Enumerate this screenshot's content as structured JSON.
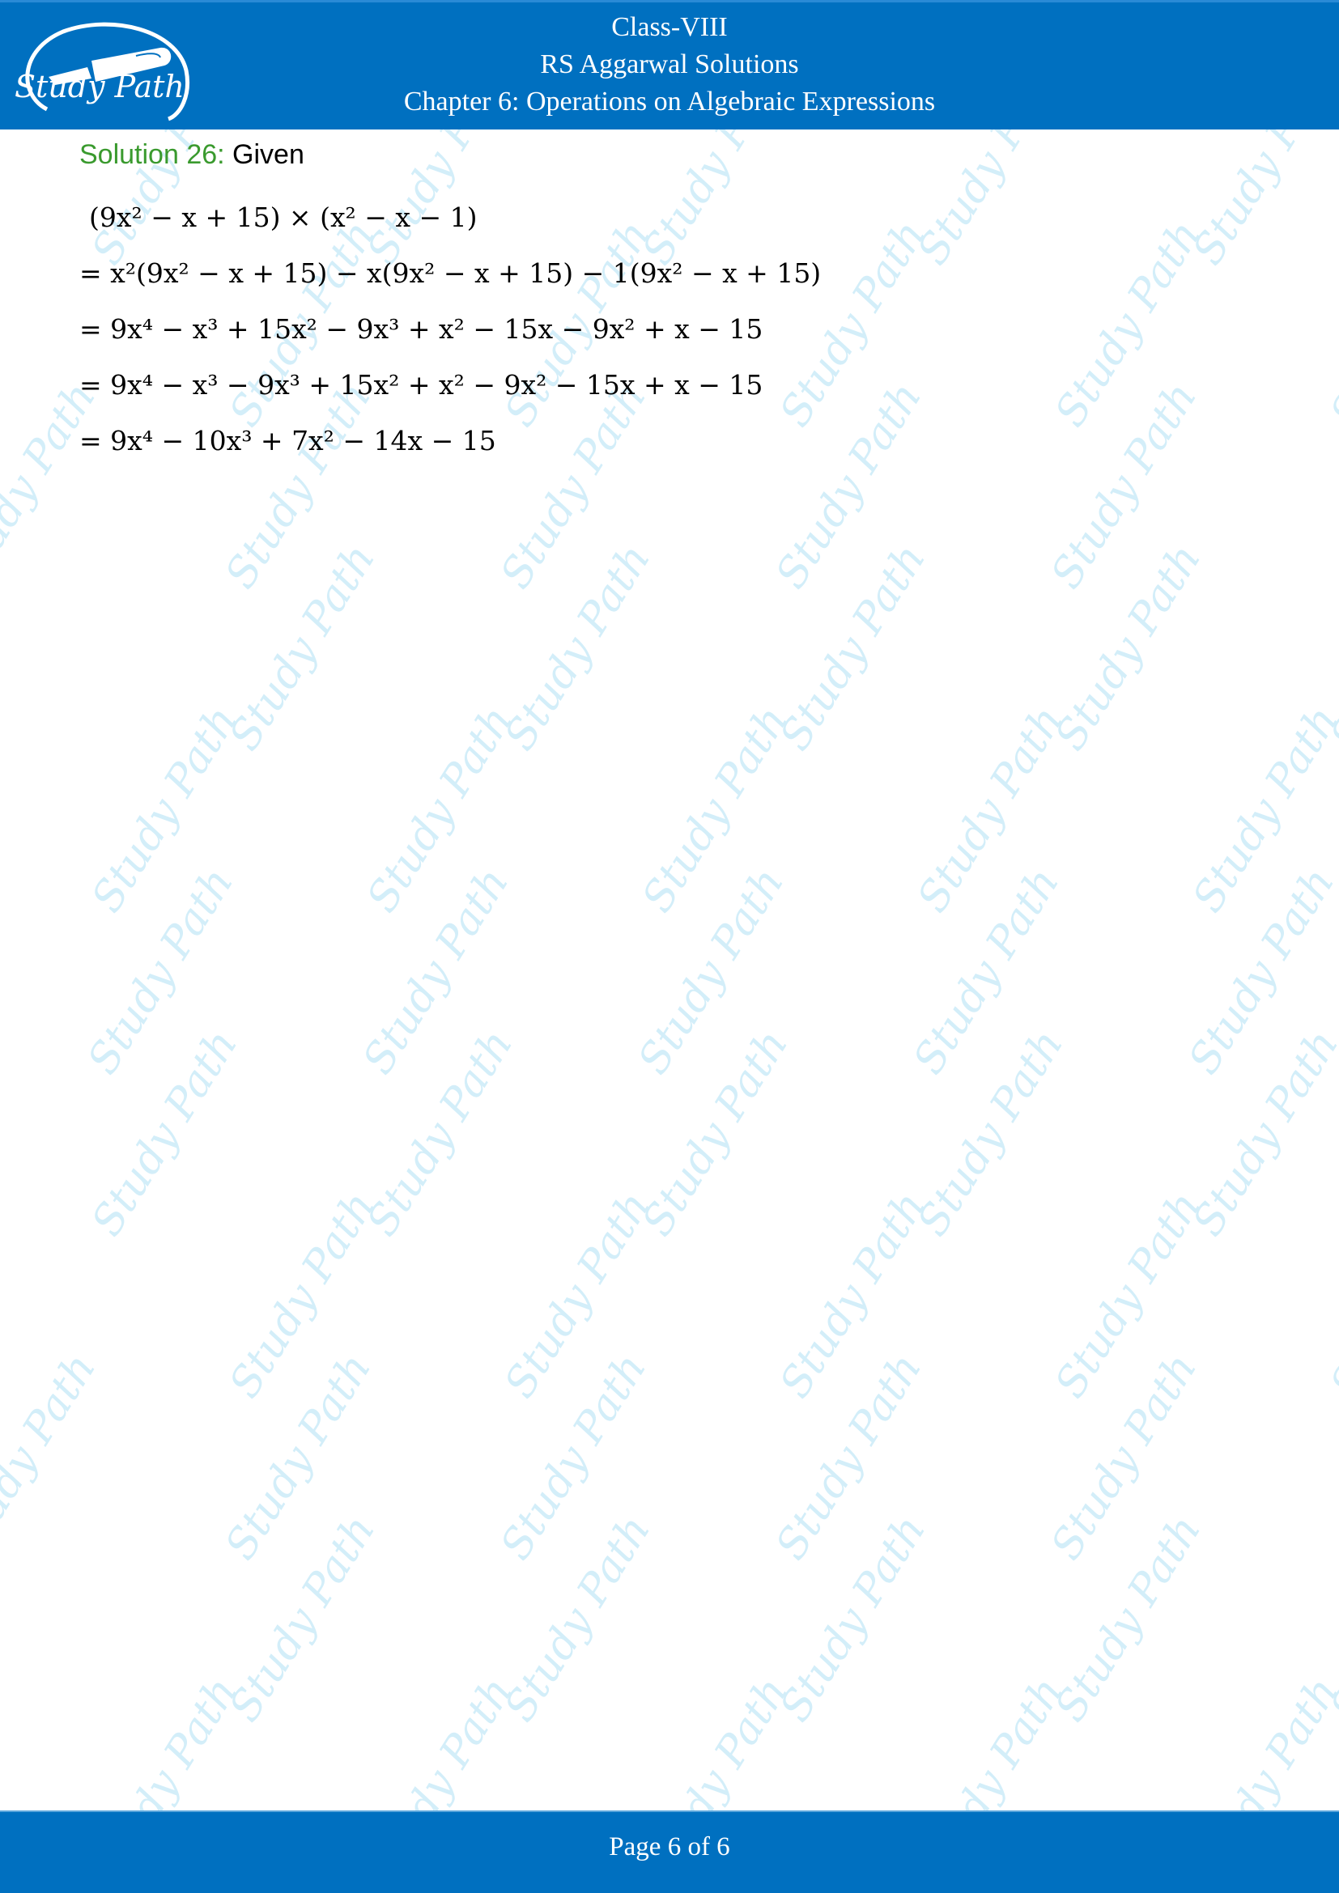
{
  "header": {
    "logo_text": "Study Path",
    "lines": [
      "Class-VIII",
      "RS Aggarwal Solutions",
      "Chapter 6: Operations on Algebraic Expressions"
    ],
    "background_color": "#0070c0"
  },
  "solution": {
    "label": "Solution 26:",
    "intro": " Given",
    "label_color": "#3a9a2e",
    "steps": [
      "(9x² − x + 15) × (x² − x − 1)",
      "= x²(9x² − x + 15) − x(9x² − x + 15) − 1(9x² − x + 15)",
      "= 9x⁴ − x³ + 15x² − 9x³ + x² − 15x − 9x² + x − 15",
      "= 9x⁴ − x³ − 9x³ + 15x² + x² − 9x² − 15x + x − 15",
      "= 9x⁴ − 10x³ + 7x² − 14x − 15"
    ]
  },
  "watermark": {
    "text": "Study Path",
    "color": "#d3eef9"
  },
  "footer": {
    "page_label": "Page 6 of 6"
  }
}
